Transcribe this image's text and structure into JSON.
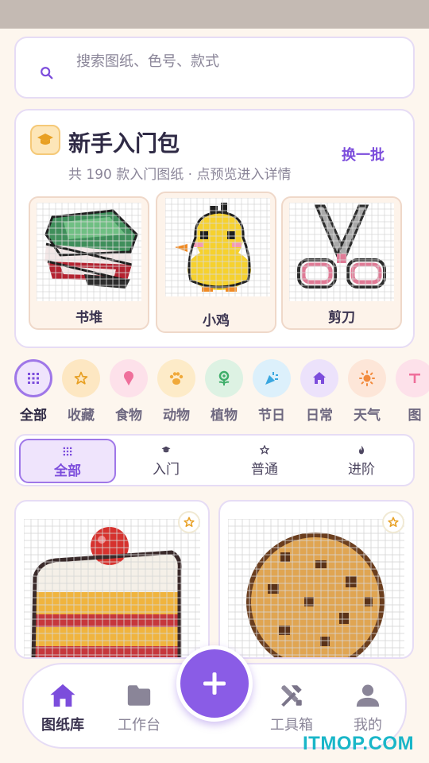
{
  "search": {
    "placeholder": "搜索图纸、色号、款式"
  },
  "starter_pack": {
    "title": "新手入门包",
    "subtitle": "共 190 款入门图纸 · 点预览进入详情",
    "refresh_label": "换一批",
    "items": [
      {
        "label": "书堆"
      },
      {
        "label": "小鸡"
      },
      {
        "label": "剪刀"
      }
    ]
  },
  "categories": [
    {
      "label": "全部",
      "icon": "grid-icon",
      "color": "#7c4ddc"
    },
    {
      "label": "收藏",
      "icon": "star-icon",
      "color": "#f0a93a"
    },
    {
      "label": "食物",
      "icon": "ice-cream-icon",
      "color": "#ef6f9b"
    },
    {
      "label": "动物",
      "icon": "paw-icon",
      "color": "#f0a93a"
    },
    {
      "label": "植物",
      "icon": "flower-icon",
      "color": "#3fae6a"
    },
    {
      "label": "节日",
      "icon": "party-popper-icon",
      "color": "#3aa7e0"
    },
    {
      "label": "日常",
      "icon": "home-icon",
      "color": "#7c4ddc"
    },
    {
      "label": "天气",
      "icon": "sun-icon",
      "color": "#f28a3c"
    },
    {
      "label": "图",
      "icon": "text-icon",
      "color": "#ef6f9b"
    }
  ],
  "difficulty_tabs": [
    {
      "label": "全部",
      "icon": "grid-icon"
    },
    {
      "label": "入门",
      "icon": "graduation-cap-icon"
    },
    {
      "label": "普通",
      "icon": "star-outline-icon"
    },
    {
      "label": "进阶",
      "icon": "flame-icon"
    }
  ],
  "patterns": [
    {
      "name": "cake",
      "icon": "cake-art"
    },
    {
      "name": "cookie",
      "icon": "cookie-art"
    }
  ],
  "nav": {
    "items": [
      {
        "label": "图纸库",
        "icon": "home-icon"
      },
      {
        "label": "工作台",
        "icon": "folder-icon"
      },
      {
        "label": "工具箱",
        "icon": "tools-icon"
      },
      {
        "label": "我的",
        "icon": "user-icon"
      }
    ],
    "fab_icon": "plus-icon"
  },
  "watermark": "ITMOP.COM",
  "colors": {
    "accent": "#7c4ddc",
    "background": "#fdf6ee",
    "border": "#e6dcf5"
  }
}
